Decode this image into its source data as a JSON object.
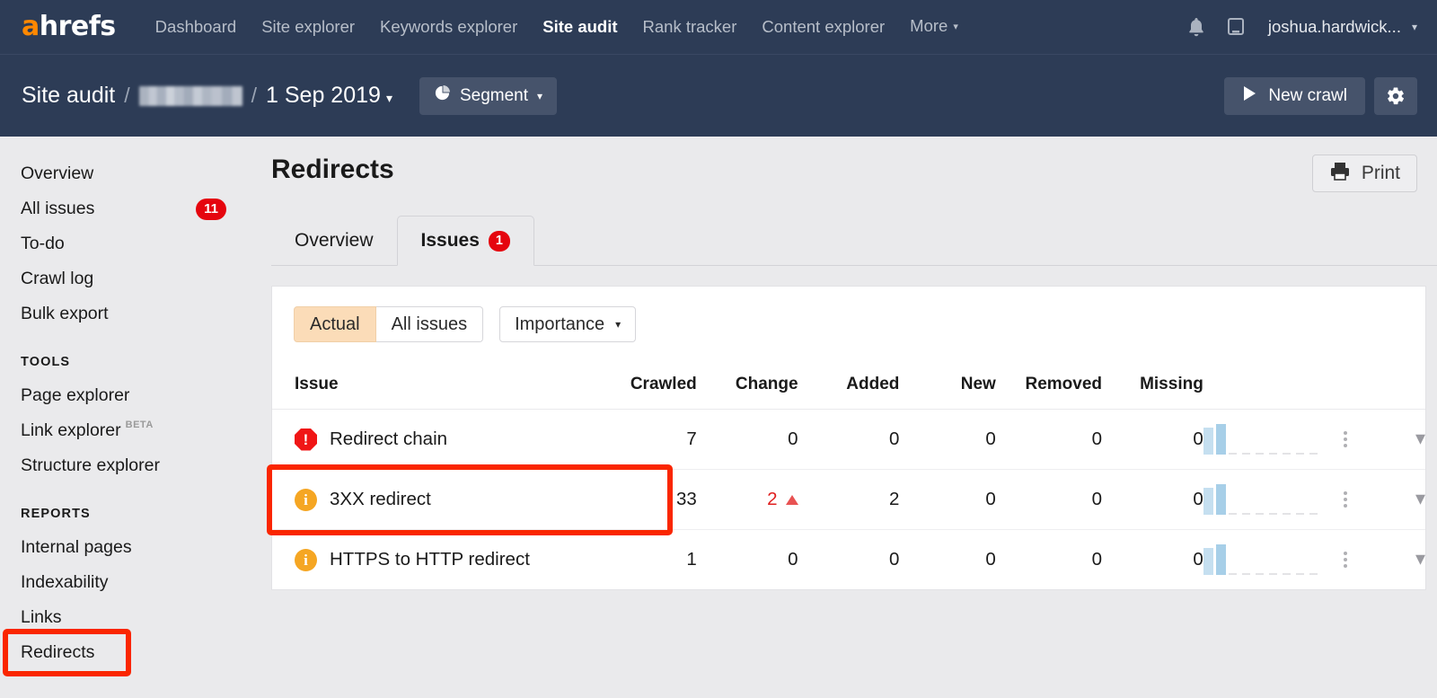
{
  "topnav": {
    "brand": "ahrefs",
    "brand_accent_letter": "a",
    "links": [
      {
        "label": "Dashboard",
        "active": false
      },
      {
        "label": "Site explorer",
        "active": false
      },
      {
        "label": "Keywords explorer",
        "active": false
      },
      {
        "label": "Site audit",
        "active": true
      },
      {
        "label": "Rank tracker",
        "active": false
      },
      {
        "label": "Content explorer",
        "active": false
      },
      {
        "label": "More",
        "active": false,
        "caret": "▾"
      }
    ],
    "notifications_icon": "bell-icon",
    "messages_icon": "chat-icon",
    "account_label": "joshua.hardwick...",
    "account_caret": "▾"
  },
  "subheader": {
    "crumb_root": "Site audit",
    "separator": "/",
    "crumb_project_redacted": "",
    "crumb_date": "1 Sep 2019",
    "crumb_date_caret": "▾",
    "segment_label": "Segment",
    "segment_caret": "▾",
    "segment_icon": "pie-chart-icon",
    "new_crawl_label": "New crawl",
    "new_crawl_icon": "play-icon",
    "settings_icon": "gear-icon"
  },
  "sidebar": {
    "items": [
      {
        "label": "Overview",
        "badge": "",
        "active": false
      },
      {
        "label": "All issues",
        "badge": "11",
        "active": false
      },
      {
        "label": "To-do",
        "badge": "",
        "active": false
      },
      {
        "label": "Crawl log",
        "badge": "",
        "active": false
      },
      {
        "label": "Bulk export",
        "badge": "",
        "active": false
      }
    ],
    "tools_header": "TOOLS",
    "tools": [
      {
        "label": "Page explorer",
        "tag": "",
        "active": false
      },
      {
        "label": "Link explorer",
        "tag": "BETA",
        "active": false
      },
      {
        "label": "Structure explorer",
        "tag": "",
        "active": false
      }
    ],
    "reports_header": "REPORTS",
    "reports": [
      {
        "label": "Internal pages",
        "active": false
      },
      {
        "label": "Indexability",
        "active": false
      },
      {
        "label": "Links",
        "active": false
      },
      {
        "label": "Redirects",
        "active": true
      }
    ]
  },
  "main": {
    "page_title": "Redirects",
    "print_label": "Print",
    "print_icon": "printer-icon",
    "tabs": [
      {
        "label": "Overview",
        "badge": "",
        "active": false
      },
      {
        "label": "Issues",
        "badge": "1",
        "active": true
      }
    ],
    "filters": {
      "segments": [
        {
          "label": "Actual",
          "active": true
        },
        {
          "label": "All issues",
          "active": false
        }
      ],
      "importance_label": "Importance",
      "importance_caret": "▾"
    },
    "table": {
      "columns": [
        "Issue",
        "Crawled",
        "Change",
        "Added",
        "New",
        "Removed",
        "Missing"
      ],
      "rows": [
        {
          "icon": "error-icon",
          "icon_glyph": "!",
          "issue": "Redirect chain",
          "crawled": "7",
          "change": "0",
          "change_dir": "",
          "change_red": false,
          "added": "0",
          "added_red": false,
          "new": "0",
          "removed": "0",
          "missing": "0",
          "menu_icon": "kebab-menu-icon",
          "expand_icon": "chevron-down-icon"
        },
        {
          "icon": "info-icon",
          "icon_glyph": "i",
          "issue": "3XX redirect",
          "crawled": "33",
          "change": "2",
          "change_dir": "up",
          "change_red": true,
          "added": "2",
          "added_red": true,
          "new": "0",
          "removed": "0",
          "missing": "0",
          "menu_icon": "kebab-menu-icon",
          "expand_icon": "chevron-down-icon"
        },
        {
          "icon": "info-icon",
          "icon_glyph": "i",
          "issue": "HTTPS to HTTP redirect",
          "crawled": "1",
          "change": "0",
          "change_dir": "",
          "change_red": false,
          "added": "0",
          "added_red": false,
          "new": "0",
          "removed": "0",
          "missing": "0",
          "menu_icon": "kebab-menu-icon",
          "expand_icon": "chevron-down-icon"
        }
      ]
    }
  },
  "annotations": {
    "highlight_color": "#fa2600",
    "highlight_targets": [
      "sidebar-item-redirects",
      "table-row-3xx-redirect"
    ]
  },
  "colors": {
    "navbar_bg": "#2d3c56",
    "brand_accent": "#ff8800",
    "badge_red": "#e5050e",
    "active_filter_bg": "#fbdcb8",
    "sparkline_bar_light": "#c5dff0",
    "sparkline_bar_dark": "#a7cfe8",
    "sidebar_bg": "#eaeaec"
  }
}
